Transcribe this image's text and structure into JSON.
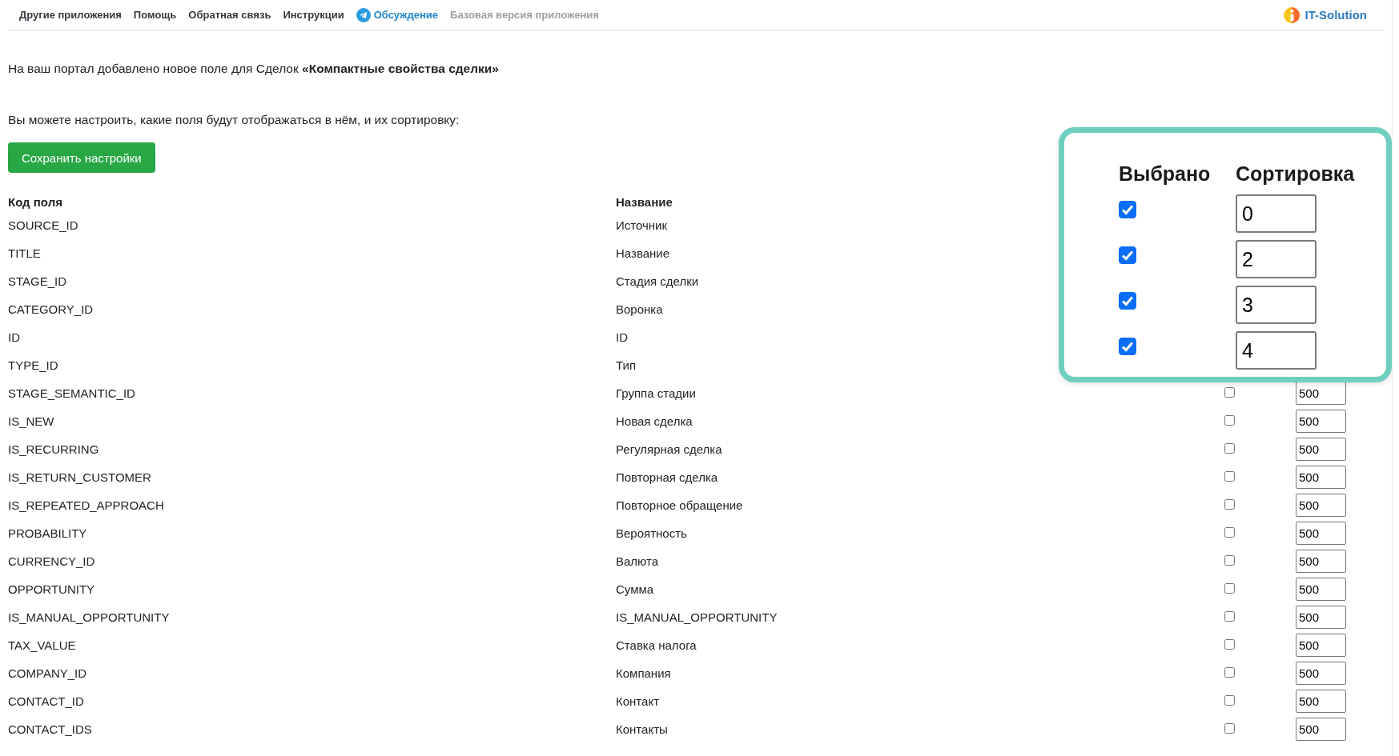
{
  "nav": {
    "items": [
      {
        "label": "Другие приложения",
        "kind": "plain"
      },
      {
        "label": "Помощь",
        "kind": "plain"
      },
      {
        "label": "Обратная связь",
        "kind": "plain"
      },
      {
        "label": "Инструкции",
        "kind": "plain"
      },
      {
        "label": "Обсуждение",
        "kind": "accent"
      },
      {
        "label": "Базовая версия приложения",
        "kind": "muted"
      }
    ],
    "logo": {
      "text": "IT-Solution"
    }
  },
  "intro": "На ваш портал добавлено новое поле для Сделок **«Компактные свойства сделки»**",
  "hint": "Вы можете настроить, какие поля будут отображаться в нём, и их сортировку:",
  "save_button": "Сохранить настройки",
  "table": {
    "columns": [
      "Код поля",
      "Название"
    ],
    "rows": [
      {
        "code": "SOURCE_ID",
        "name": "Источник"
      },
      {
        "code": "TITLE",
        "name": "Название"
      },
      {
        "code": "STAGE_ID",
        "name": "Стадия сделки"
      },
      {
        "code": "CATEGORY_ID",
        "name": "Воронка"
      },
      {
        "code": "ID",
        "name": "ID"
      },
      {
        "code": "TYPE_ID",
        "name": "Тип"
      },
      {
        "code": "STAGE_SEMANTIC_ID",
        "name": "Группа стадии",
        "checked": false,
        "sort": "500"
      },
      {
        "code": "IS_NEW",
        "name": "Новая сделка",
        "checked": false,
        "sort": "500"
      },
      {
        "code": "IS_RECURRING",
        "name": "Регулярная сделка",
        "checked": false,
        "sort": "500"
      },
      {
        "code": "IS_RETURN_CUSTOMER",
        "name": "Повторная сделка",
        "checked": false,
        "sort": "500"
      },
      {
        "code": "IS_REPEATED_APPROACH",
        "name": "Повторное обращение",
        "checked": false,
        "sort": "500"
      },
      {
        "code": "PROBABILITY",
        "name": "Вероятность",
        "checked": false,
        "sort": "500"
      },
      {
        "code": "CURRENCY_ID",
        "name": "Валюта",
        "checked": false,
        "sort": "500"
      },
      {
        "code": "OPPORTUNITY",
        "name": "Сумма",
        "checked": false,
        "sort": "500"
      },
      {
        "code": "IS_MANUAL_OPPORTUNITY",
        "name": "IS_MANUAL_OPPORTUNITY",
        "checked": false,
        "sort": "500"
      },
      {
        "code": "TAX_VALUE",
        "name": "Ставка налога",
        "checked": false,
        "sort": "500"
      },
      {
        "code": "COMPANY_ID",
        "name": "Компания",
        "checked": false,
        "sort": "500"
      },
      {
        "code": "CONTACT_ID",
        "name": "Контакт",
        "checked": false,
        "sort": "500"
      },
      {
        "code": "CONTACT_IDS",
        "name": "Контакты",
        "checked": false,
        "sort": "500"
      }
    ]
  },
  "callout": {
    "columns": [
      "Выбрано",
      "Сортировка"
    ],
    "rows": [
      {
        "checked": true,
        "sort": "0"
      },
      {
        "checked": true,
        "sort": "2"
      },
      {
        "checked": true,
        "sort": "3"
      },
      {
        "checked": true,
        "sort": "4"
      }
    ]
  }
}
